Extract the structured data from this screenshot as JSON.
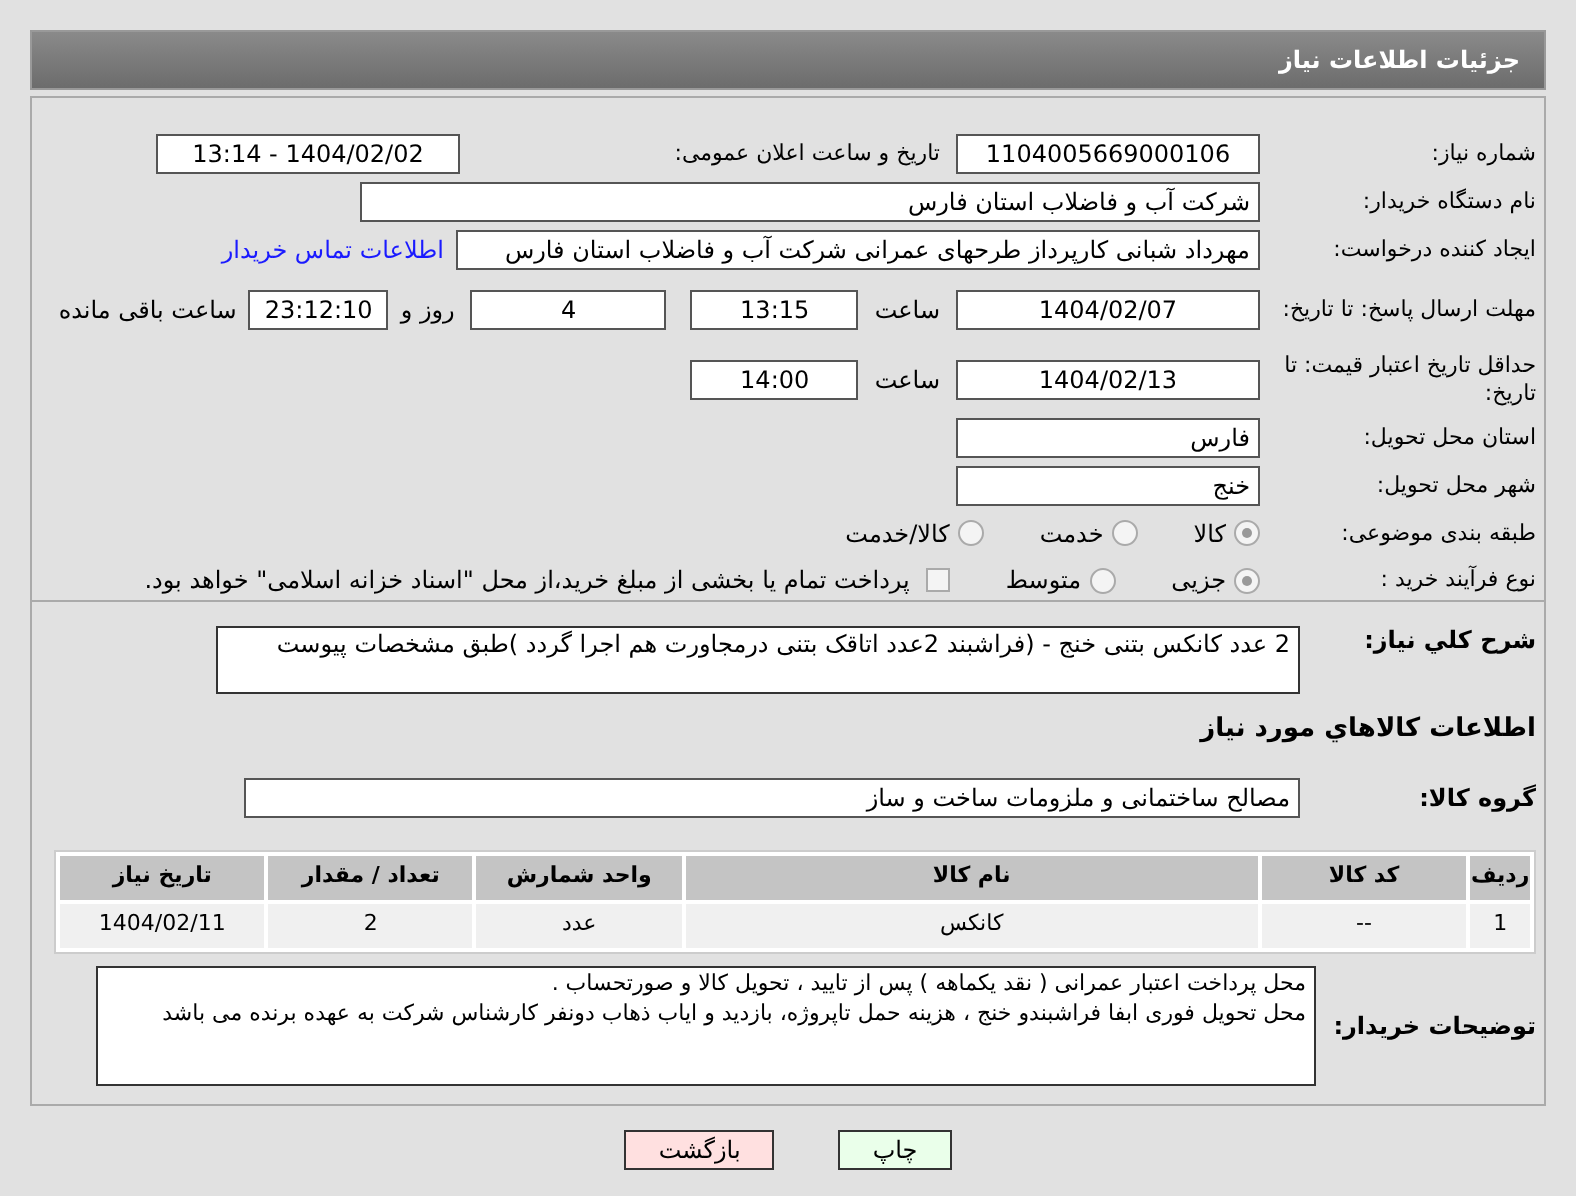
{
  "header": {
    "title": "جزئیات اطلاعات نیاز"
  },
  "need_number": {
    "label": "شماره نیاز:",
    "value": "1104005669000106"
  },
  "announce": {
    "label": "تاریخ و ساعت اعلان عمومی:",
    "value": "1404/02/02 - 13:14"
  },
  "buyer": {
    "label": "نام دستگاه خریدار:",
    "value": "شرکت آب و فاضلاب استان فارس"
  },
  "creator": {
    "label": "ایجاد کننده درخواست:",
    "value": "مهرداد شبانی کارپرداز طرحهای عمرانی  شرکت آب و فاضلاب استان فارس",
    "link": "اطلاعات تماس خریدار"
  },
  "deadline": {
    "label": "مهلت ارسال پاسخ: تا تاریخ:",
    "date": "1404/02/07",
    "time_label": "ساعت",
    "time": "13:15",
    "days": "4",
    "days_label": "روز و",
    "remaining": "23:12:10",
    "remaining_label": "ساعت باقی مانده"
  },
  "validity": {
    "label": "حداقل تاریخ اعتبار قیمت: تا تاریخ:",
    "date": "1404/02/13",
    "time_label": "ساعت",
    "time": "14:00"
  },
  "province": {
    "label": "استان محل تحویل:",
    "value": "فارس"
  },
  "city": {
    "label": "شهر محل تحویل:",
    "value": "خنج"
  },
  "category": {
    "label": "طبقه بندی موضوعی:",
    "options": [
      {
        "label": "کالا",
        "selected": true
      },
      {
        "label": "خدمت",
        "selected": false
      },
      {
        "label": "کالا/خدمت",
        "selected": false
      }
    ]
  },
  "purchase_type": {
    "label": "نوع فرآیند خرید :",
    "options": [
      {
        "label": "جزیی",
        "selected": true
      },
      {
        "label": "متوسط",
        "selected": false
      }
    ],
    "payment": {
      "label": "پرداخت تمام یا بخشی از مبلغ خرید،از محل \"اسناد خزانه اسلامی\" خواهد بود.",
      "checked": false
    }
  },
  "description": {
    "label": "شرح کلي نياز:",
    "value": "2 عدد کانکس بتنی  خنج - (فراشبند  2عدد اتاقک بتنی درمجاورت هم  اجرا گردد )طبق مشخصات پیوست"
  },
  "goods": {
    "title": "اطلاعات کالاهاي مورد نياز",
    "group": {
      "label": "گروه کالا:",
      "value": "مصالح ساختمانی و ملزومات ساخت و ساز"
    },
    "table": {
      "columns": [
        "ردیف",
        "کد کالا",
        "نام کالا",
        "واحد شمارش",
        "تعداد / مقدار",
        "تاریخ نیاز"
      ],
      "rows": [
        [
          "1",
          "--",
          "کانکس",
          "عدد",
          "2",
          "1404/02/11"
        ]
      ]
    }
  },
  "buyer_notes": {
    "label": "توضیحات خریدار:",
    "lines": [
      "محل پرداخت اعتبار عمرانی ( نقد یکماهه ) پس از تایید ، تحویل کالا و صورتحساب .",
      "محل تحویل فوری ابفا فراشبندو خنج ، هزینه حمل تاپروژه، بازدید و ایاب ذهاب دونفر کارشناس شرکت به عهده برنده می باشد"
    ]
  },
  "buttons": [
    {
      "label": "چاپ",
      "kind": "print"
    },
    {
      "label": "بازگشت",
      "kind": "back"
    }
  ]
}
